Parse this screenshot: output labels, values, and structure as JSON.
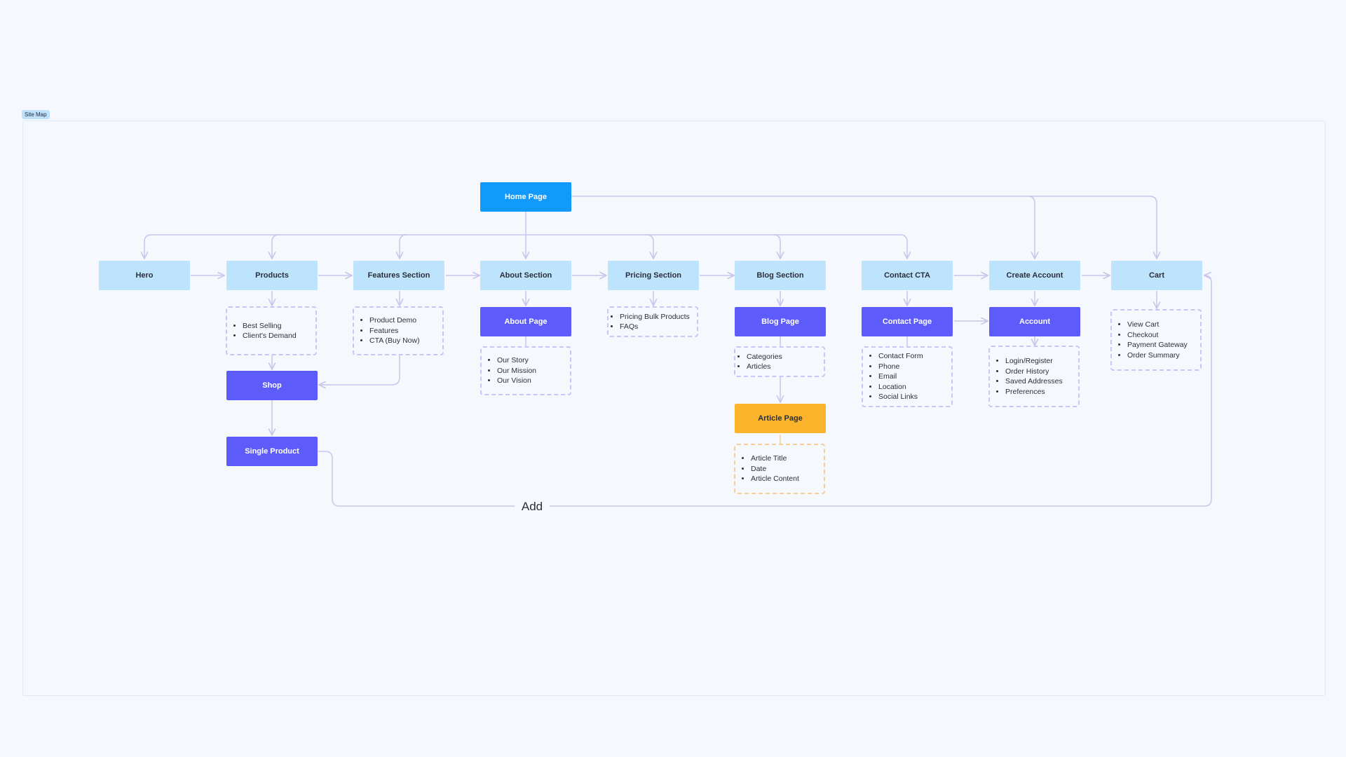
{
  "frame": {
    "label": "Site Map"
  },
  "colors": {
    "root": "#1199fb",
    "section": "#bee3fc",
    "page": "#5d5cfa",
    "article": "#fbb42c",
    "connector": "#c9c6ea",
    "dashed_border": "#c8c5f7",
    "dashed_border_orange": "#f8cd9a"
  },
  "nodes": {
    "home": "Home Page",
    "hero": "Hero",
    "products": "Products",
    "features": "Features Section",
    "about": "About Section",
    "pricing": "Pricing Section",
    "blog": "Blog Section",
    "contact_cta": "Contact CTA",
    "create_account": "Create Account",
    "cart": "Cart",
    "shop": "Shop",
    "single_product": "Single Product",
    "about_page": "About Page",
    "blog_page": "Blog Page",
    "article_page": "Article Page",
    "contact_page": "Contact Page",
    "account": "Account"
  },
  "lists": {
    "products": [
      "Best Selling",
      "Client's Demand"
    ],
    "features": [
      "Product Demo",
      "Features",
      "CTA (Buy Now)"
    ],
    "about_page": [
      "Our Story",
      "Our Mission",
      "Our Vision"
    ],
    "pricing": [
      "Pricing Bulk Products",
      "FAQs"
    ],
    "blog_page": [
      "Categories",
      "Articles"
    ],
    "article_page": [
      "Article Title",
      "Date",
      "Article Content"
    ],
    "contact_page": [
      "Contact Form",
      "Phone",
      "Email",
      "Location",
      "Social Links"
    ],
    "account": [
      "Login/Register",
      "Order History",
      "Saved Addresses",
      "Preferences"
    ],
    "cart": [
      "View Cart",
      "Checkout",
      "Payment Gateway",
      "Order Summary"
    ]
  },
  "edge_labels": {
    "add": "Add"
  }
}
